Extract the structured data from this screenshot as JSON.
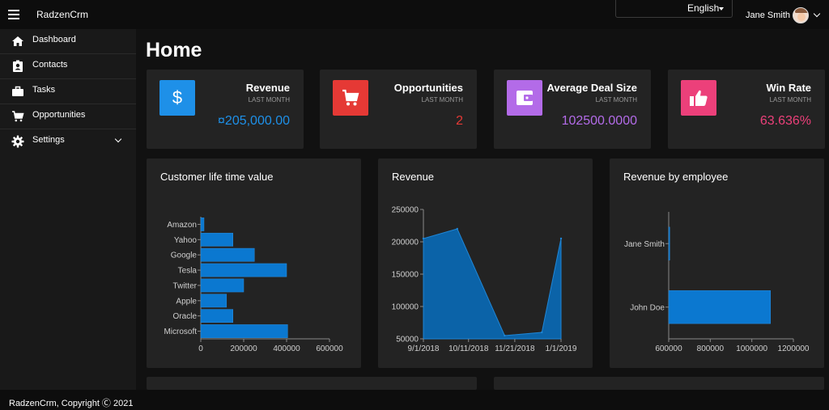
{
  "header": {
    "app_title": "RadzenCrm",
    "language": "English",
    "user_name": "Jane Smith"
  },
  "sidebar": {
    "items": [
      {
        "label": "Dashboard",
        "icon": "home-icon"
      },
      {
        "label": "Contacts",
        "icon": "contact-card-icon"
      },
      {
        "label": "Tasks",
        "icon": "briefcase-icon"
      },
      {
        "label": "Opportunities",
        "icon": "cart-icon"
      },
      {
        "label": "Settings",
        "icon": "gear-icon",
        "expandable": true
      }
    ]
  },
  "page": {
    "title": "Home"
  },
  "kpis": [
    {
      "title": "Revenue",
      "sub": "LAST MONTH",
      "value": "¤205,000.00",
      "color": "#1e90e8",
      "icon": "dollar-icon"
    },
    {
      "title": "Opportunities",
      "sub": "LAST MONTH",
      "value": "2",
      "color": "#e53935",
      "icon": "cart-icon"
    },
    {
      "title": "Average Deal Size",
      "sub": "LAST MONTH",
      "value": "102500.0000",
      "color": "#b36be8",
      "icon": "wallet-icon"
    },
    {
      "title": "Win Rate",
      "sub": "LAST MONTH",
      "value": "63.636%",
      "color": "#ec407a",
      "icon": "thumbs-up-icon"
    }
  ],
  "chart_data": [
    {
      "type": "bar",
      "orientation": "horizontal",
      "title": "Customer life time value",
      "categories": [
        "Amazon",
        "Yahoo",
        "Google",
        "Tesla",
        "Twitter",
        "Apple",
        "Oracle",
        "Microsoft"
      ],
      "values": [
        15000,
        150000,
        250000,
        400000,
        200000,
        120000,
        150000,
        405000
      ],
      "xlim": [
        0,
        600000
      ],
      "xticks": [
        "0",
        "200000",
        "400000",
        "600000"
      ],
      "color": "#0b78d0"
    },
    {
      "type": "area",
      "title": "Revenue",
      "x": [
        "9/1/2018",
        "10/1/2018",
        "11/12/2018",
        "12/15/2018",
        "1/1/2019"
      ],
      "values": [
        205000,
        220000,
        55000,
        60000,
        205000
      ],
      "ylim": [
        50000,
        250000
      ],
      "xticks": [
        "9/1/2018",
        "10/11/2018",
        "11/21/2018",
        "1/1/2019"
      ],
      "yticks": [
        "50000",
        "100000",
        "150000",
        "200000",
        "250000"
      ],
      "color": "#0b63a8"
    },
    {
      "type": "bar",
      "orientation": "horizontal",
      "title": "Revenue by employee",
      "categories": [
        "Jane Smith",
        "John Doe"
      ],
      "values": [
        605000,
        1090000
      ],
      "xlim": [
        600000,
        1200000
      ],
      "xticks": [
        "600000",
        "800000",
        "1000000",
        "1200000"
      ],
      "color": "#0b78d0"
    }
  ],
  "footer": {
    "text": "RadzenCrm, Copyright Ⓒ 2021"
  }
}
